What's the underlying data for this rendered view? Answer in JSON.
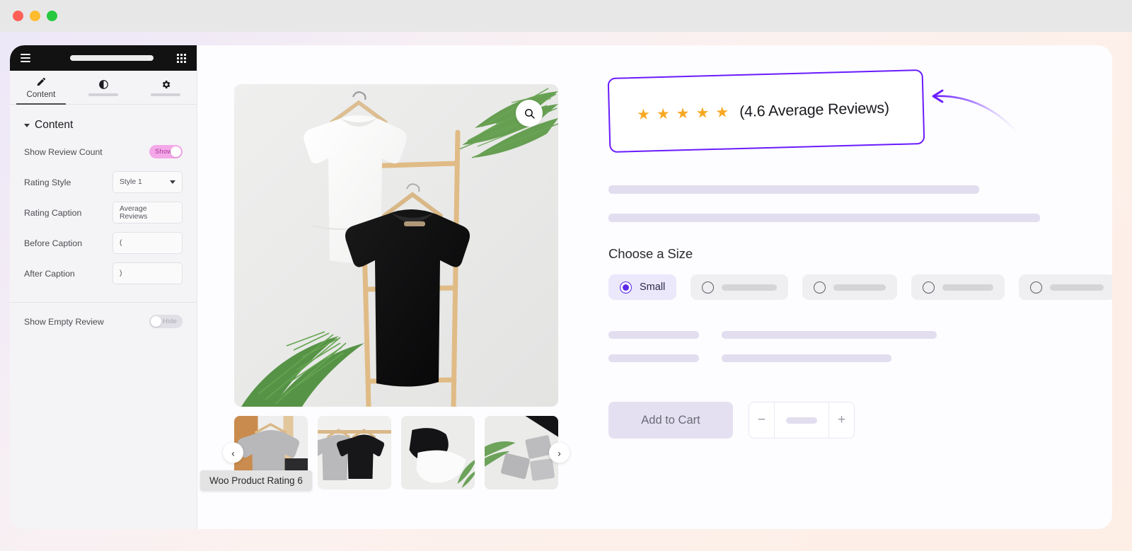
{
  "window": {
    "traffic_lights": [
      "close",
      "minimize",
      "maximize"
    ]
  },
  "sidebar": {
    "topbar": {
      "menu_icon": "hamburger-icon",
      "apps_icon": "grid-icon"
    },
    "tabs": [
      {
        "id": "content",
        "icon": "pencil-icon",
        "label": "Content",
        "active": true,
        "skeleton": false
      },
      {
        "id": "style",
        "icon": "contrast-icon",
        "label": "",
        "active": false,
        "skeleton": true
      },
      {
        "id": "advanced",
        "icon": "gear-icon",
        "label": "",
        "active": false,
        "skeleton": true
      }
    ],
    "section": {
      "title": "Content",
      "caret": "chevron-down-icon"
    },
    "controls": {
      "show_review_count": {
        "label": "Show Review Count",
        "toggle_state": "on",
        "toggle_text": "Show"
      },
      "rating_style": {
        "label": "Rating Style",
        "value": "Style 1",
        "caret": "chevron-down-icon"
      },
      "rating_caption": {
        "label": "Rating Caption",
        "value": "Average Reviews"
      },
      "before_caption": {
        "label": "Before Caption",
        "value": "("
      },
      "after_caption": {
        "label": "After Caption",
        "value": ")"
      },
      "show_empty_review": {
        "label": "Show Empty Review",
        "toggle_state": "off",
        "toggle_text": "Hide"
      }
    }
  },
  "gallery": {
    "zoom_icon": "search-icon",
    "prev_label": "‹",
    "next_label": "›",
    "tooltip": "Woo Product Rating 6",
    "thumbnail_count": 4
  },
  "product": {
    "rating": {
      "stars_filled": 5,
      "star_glyph": "★",
      "before_caption": "(",
      "value": "4.6",
      "caption": "Average Reviews",
      "after_caption": ")",
      "display_text": "(4.6 Average Reviews)",
      "highlight_color": "#6a1bff",
      "star_color": "#f7a823"
    },
    "size_section": {
      "title": "Choose a Size",
      "options": [
        {
          "label": "Small",
          "selected": true,
          "skeleton_width": 0
        },
        {
          "label": "",
          "selected": false,
          "skeleton_width": 78
        },
        {
          "label": "",
          "selected": false,
          "skeleton_width": 74
        },
        {
          "label": "",
          "selected": false,
          "skeleton_width": 72
        },
        {
          "label": "",
          "selected": false,
          "skeleton_width": 76
        }
      ]
    },
    "skeleton_rows": [
      {
        "left_width": 128,
        "right_width": 304
      },
      {
        "left_width": 128,
        "right_width": 240
      }
    ],
    "cart": {
      "add_to_cart_label": "Add to Cart",
      "decrement_label": "−",
      "increment_label": "+"
    }
  },
  "colors": {
    "accent_purple": "#6a1bff",
    "selected_radio": "#5d2ae8",
    "star": "#f7a823",
    "toggle_on": "#f5a8e8",
    "toggle_off": "#dfdfe5",
    "skeleton": "#e2def0"
  }
}
